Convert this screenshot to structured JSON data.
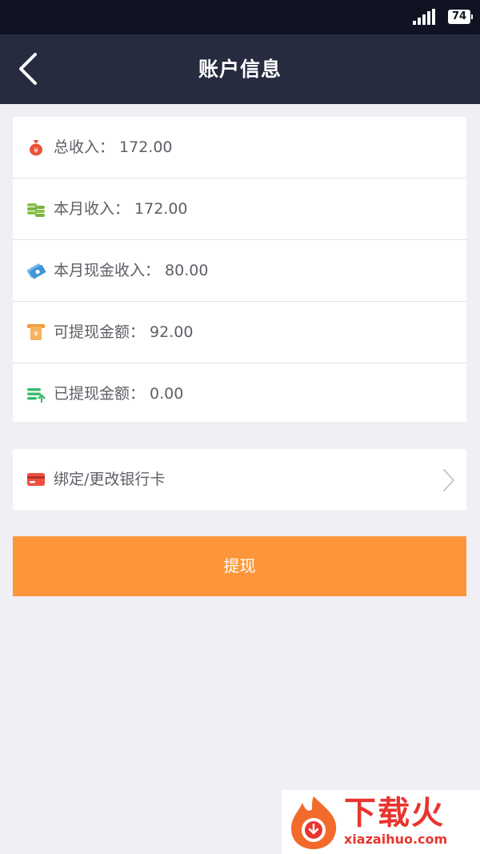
{
  "status_bar": {
    "battery": "74",
    "signal_icon": "signal-icon"
  },
  "nav": {
    "title": "账户信息",
    "back_icon": "chevron-left-icon"
  },
  "account_rows": [
    {
      "icon": "money-bag-icon",
      "label": "总收入：",
      "value": "172.00",
      "text": "总收入：  172.00"
    },
    {
      "icon": "coins-icon",
      "label": "本月收入：",
      "value": "172.00",
      "text": "本月收入：  172.00"
    },
    {
      "icon": "cash-bills-icon",
      "label": "本月现金收入：",
      "value": "80.00",
      "text": "本月现金收入：  80.00"
    },
    {
      "icon": "withdrawable-icon",
      "label": "可提现金额：",
      "value": "92.00",
      "text": "可提现金额：  92.00"
    },
    {
      "icon": "withdrawn-icon",
      "label": "已提现金额：",
      "value": "0.00",
      "text": "已提现金额：  0.00"
    }
  ],
  "bank_card": {
    "label": "绑定/更改银行卡",
    "icon": "bank-card-icon"
  },
  "withdraw_button": {
    "label": "提现"
  },
  "watermark": {
    "brand_cn": "下载火",
    "brand_en": "xiazaihuo.com"
  },
  "colors": {
    "status_bar": "#101322",
    "nav_bar": "#262b40",
    "background": "#efeff4",
    "accent": "#fd963a",
    "text": "#5e5e66"
  }
}
